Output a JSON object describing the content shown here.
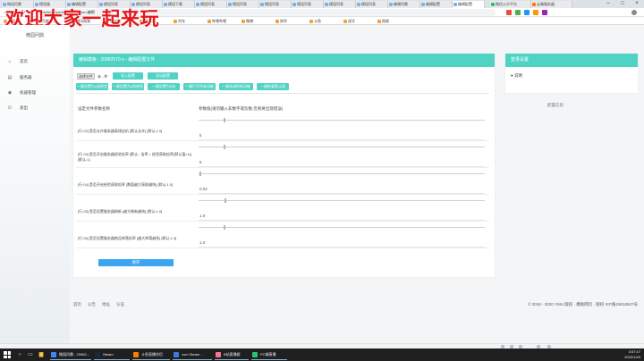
{
  "overlay": {
    "text": "欢迎大家一起来玩"
  },
  "browser": {
    "tabs": [
      "微园问鼎",
      "模组服",
      "编辑配置",
      "模组列表",
      "模组列表",
      "模组下载",
      "模组列表",
      "模组列表",
      "模组列表",
      "模组列表",
      "模组列表",
      "模组列表",
      "编辑问鼎",
      "编辑配置",
      "编辑配置"
    ],
    "active_tab": 14,
    "right_tabs": [
      "微信公众平台",
      "云端服务器"
    ],
    "url": "/admin/properties/edit?action=编辑",
    "bookmarks": [
      "应用",
      "百度一下",
      "腾讯视频",
      "淘宝网",
      "爱奇艺",
      "京东",
      "哔哩哔哩",
      "微博",
      "知乎",
      "斗鱼",
      "虎牙",
      "网易"
    ],
    "window_controls": {
      "minimize": "–",
      "maximize": "□",
      "close": "×"
    },
    "nav": {
      "back": "←",
      "forward": "→",
      "reload": "↻"
    }
  },
  "sidebar": {
    "title": "微园问鼎",
    "items": [
      {
        "label": "首页",
        "icon": "home-icon",
        "glyph": "⌂"
      },
      {
        "label": "服务器",
        "icon": "server-icon",
        "glyph": "▤"
      },
      {
        "label": "机器管理",
        "icon": "robot-icon",
        "glyph": "◉"
      },
      {
        "label": "退出",
        "icon": "logout-icon",
        "glyph": "⏻"
      }
    ]
  },
  "main": {
    "title": "编辑模板 - 20982570-x - 编辑配置文件",
    "file_button": "选择文件",
    "file_status": "未...件",
    "import_label": "导入配置",
    "export_label": "导出配置",
    "quick_buttons": [
      "一键设置为1倍经验",
      "一键设置为2倍经验",
      "一键设置为5倍",
      "一键打开所有功能",
      "一键关闭所有功能",
      "一键恢复默认值"
    ],
    "col_name": "设定文件参数名称",
    "col_value": "参数值(请勿输入非数字或负数,否则将出现错误)",
    "rows": [
      {
        "label": "[行 02] 是否允许服务器离线挂机 [默认允许] [默认:1.0]",
        "value": "5",
        "fill": 0.09
      },
      {
        "label": "[行 03] 是否开启服务器经验倍率 [默认 : 倍率 = 经验获取倍率(默认值=1)] [默认:1]",
        "value": "5",
        "fill": 0.09
      },
      {
        "label": "[行 04] 是否开启经验获取倍率 [数值越大获取越快] [默认:1.0]",
        "value": "0.02",
        "fill": 0.006
      },
      {
        "label": "[行 05] 是否设置服务器刷新 [越大刷新越快] [默认:1.0]",
        "value": "1.0",
        "fill": 0.095
      },
      {
        "label": "[行 06] 是否设置服务器物品掉落倍率 [越大掉落越多] [默认:1.0]",
        "value": "1.0",
        "fill": 0.09
      }
    ],
    "save_label": "保存"
  },
  "side_panel": {
    "title": "登录设置",
    "item": "● 说明"
  },
  "side_note": "配置信息",
  "footer": {
    "links": [
      "首页",
      "公告",
      "地址",
      "认证"
    ],
    "copyright": "© 2018 - 2020 YMU 版权 · 模板网页 · 版权 ICP备19010847号"
  },
  "taskbar": {
    "apps": [
      {
        "label": "微园问鼎 - 20982...",
        "color": "#4285f4"
      },
      {
        "label": "Steam",
        "color": "#1b2838"
      },
      {
        "label": "斗鱼直播伴侣",
        "color": "#ff7a00"
      },
      {
        "label": "com Steam ...",
        "color": "#3d7bd9"
      },
      {
        "label": "B站直播姬",
        "color": "#fb7299"
      },
      {
        "label": "PC端直播",
        "color": "#2cc36b"
      }
    ],
    "time": "3:57:47",
    "date": "2020/10/9"
  },
  "colors": {
    "teal": "#4fd3c4",
    "blue": "#3aa6f2",
    "overlay_red": "#e4161c"
  }
}
